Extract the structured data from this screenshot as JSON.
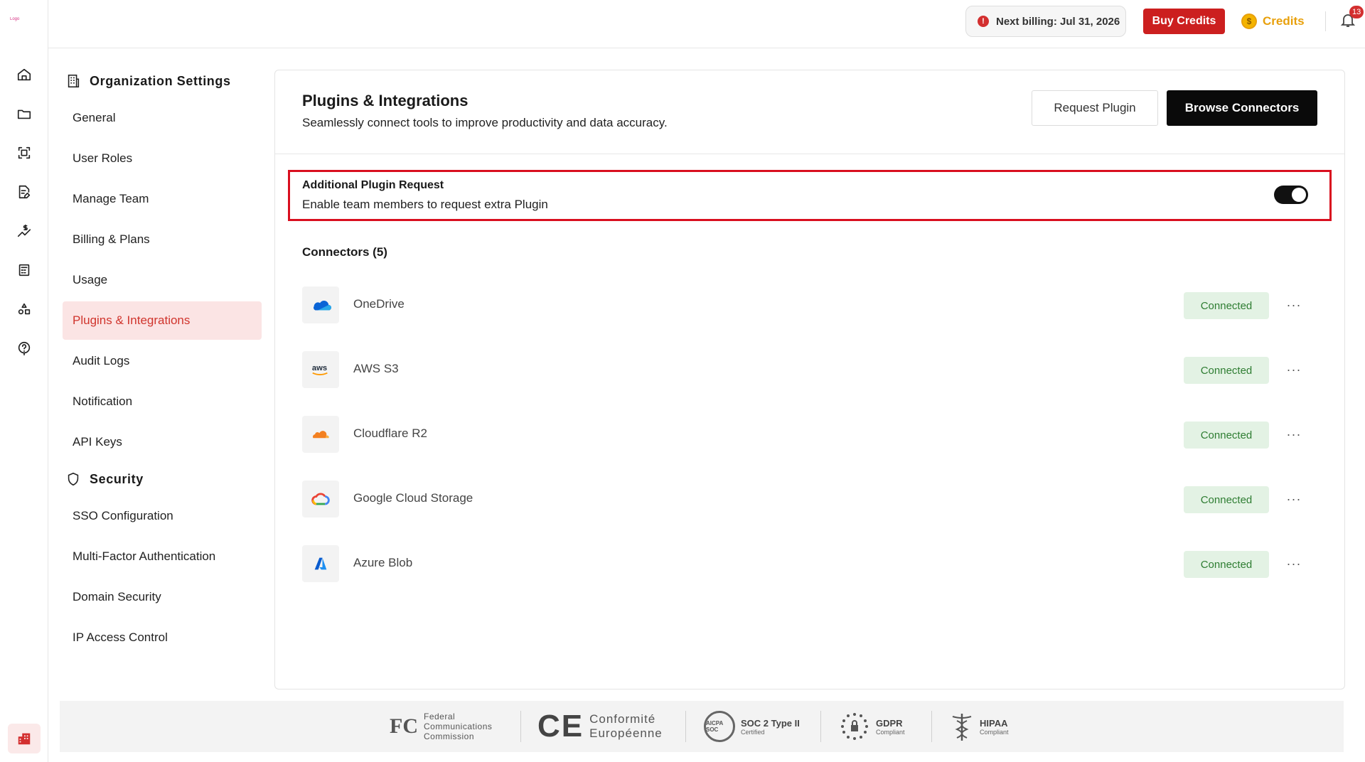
{
  "rail": {
    "logo_text": "Logo",
    "items": [
      {
        "icon": "home-icon"
      },
      {
        "icon": "folder-icon"
      },
      {
        "icon": "scan-icon"
      },
      {
        "icon": "document-edit-icon"
      },
      {
        "icon": "pricing-trend-icon"
      },
      {
        "icon": "calculator-icon"
      },
      {
        "icon": "shapes-icon"
      },
      {
        "icon": "help-icon"
      }
    ],
    "bottom_icon": "organization-icon"
  },
  "topbar": {
    "billing_label": "Next billing: Jul 31, 2026",
    "buy_credits_label": "Buy Credits",
    "credits_label": "Credits",
    "credits_coin_symbol": "$",
    "notification_count": "13"
  },
  "sidebar": {
    "org_heading": "Organization Settings",
    "org_items": [
      {
        "label": "General"
      },
      {
        "label": "User Roles"
      },
      {
        "label": "Manage Team"
      },
      {
        "label": "Billing & Plans"
      },
      {
        "label": "Usage"
      },
      {
        "label": "Plugins & Integrations",
        "active": true
      },
      {
        "label": "Audit Logs"
      },
      {
        "label": "Notification"
      },
      {
        "label": "API Keys"
      }
    ],
    "security_heading": "Security",
    "security_items": [
      {
        "label": "SSO Configuration"
      },
      {
        "label": "Multi-Factor Authentication"
      },
      {
        "label": "Domain Security"
      },
      {
        "label": "IP Access Control"
      }
    ]
  },
  "main": {
    "title": "Plugins & Integrations",
    "subtitle": "Seamlessly connect tools to improve productivity and data accuracy.",
    "request_plugin_label": "Request Plugin",
    "browse_connectors_label": "Browse Connectors",
    "request_setting": {
      "title": "Additional Plugin Request",
      "description": "Enable team members to request extra Plugin",
      "enabled": true
    },
    "connectors_heading": "Connectors (5)",
    "connectors": [
      {
        "name": "OneDrive",
        "status": "Connected",
        "icon": "onedrive-icon"
      },
      {
        "name": "AWS S3",
        "status": "Connected",
        "icon": "aws-icon"
      },
      {
        "name": "Cloudflare R2",
        "status": "Connected",
        "icon": "cloudflare-icon"
      },
      {
        "name": "Google Cloud Storage",
        "status": "Connected",
        "icon": "google-cloud-icon"
      },
      {
        "name": "Azure Blob",
        "status": "Connected",
        "icon": "azure-icon"
      }
    ],
    "more_label": "···"
  },
  "footer": {
    "fcc": {
      "mark": "FC",
      "line1": "Federal",
      "line2": "Communications",
      "line3": "Commission"
    },
    "ce": {
      "mark": "CE",
      "line1": "Conformité",
      "line2": "Européenne"
    },
    "soc": {
      "badge": "AICPA SOC",
      "title": "SOC 2 Type II",
      "sub": "Certified"
    },
    "gdpr": {
      "title": "GDPR",
      "sub": "Compliant"
    },
    "hipaa": {
      "title": "HIPAA",
      "sub": "Compliant"
    }
  },
  "colors": {
    "brand_red": "#cc1f1f",
    "active_nav_bg": "#fbe4e4",
    "active_nav_text": "#d0342c",
    "connected_bg": "#e3f2e4",
    "connected_text": "#2e7d32",
    "credits_gold": "#e8a00c",
    "highlight_border": "#d90f1f"
  }
}
